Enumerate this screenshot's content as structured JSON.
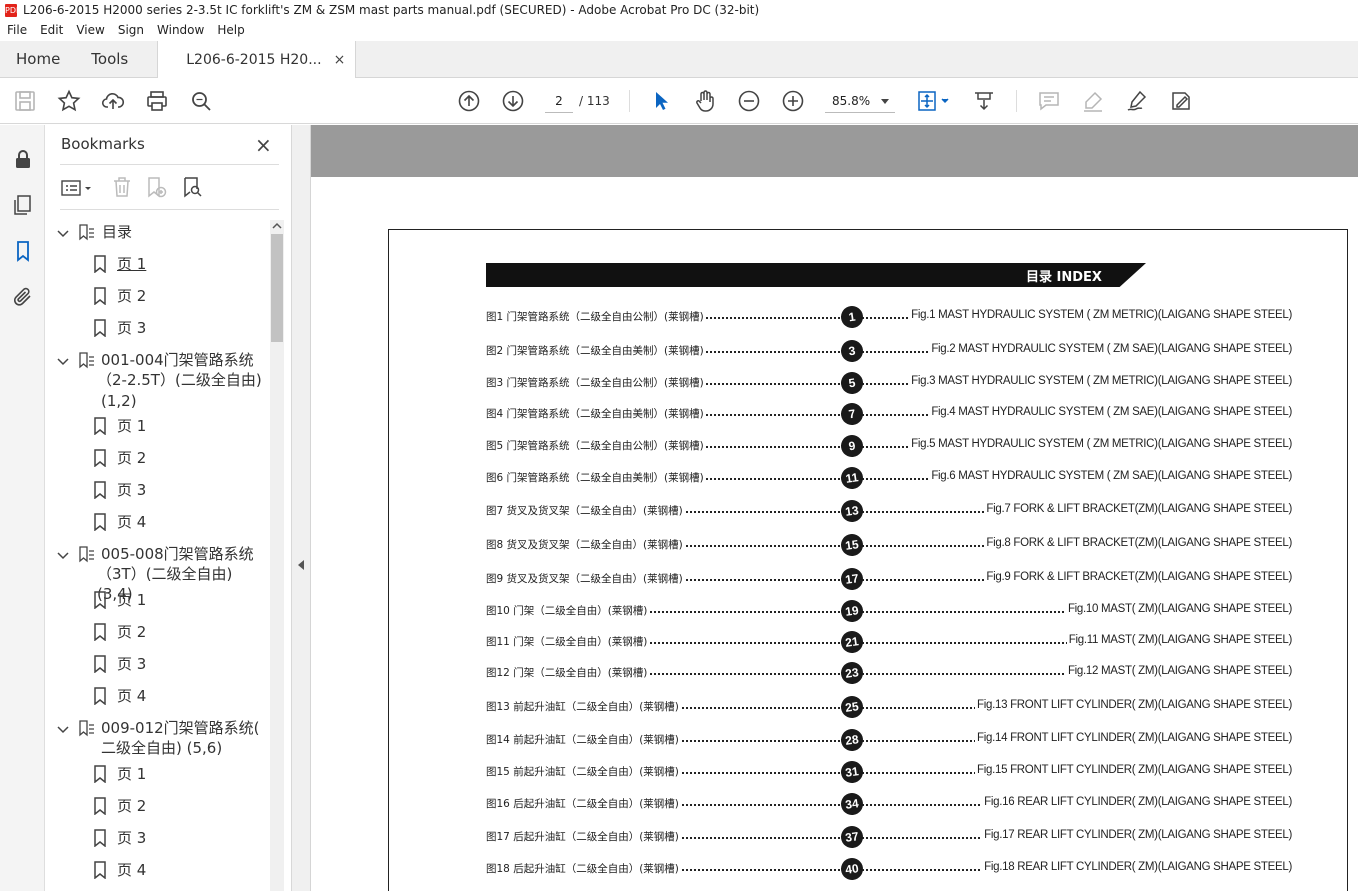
{
  "window": {
    "title": "L206-6-2015 H2000 series 2-3.5t IC forklift's ZM & ZSM mast parts manual.pdf (SECURED) - Adobe Acrobat Pro DC (32-bit)",
    "icon_label": "PDF"
  },
  "menu": [
    "File",
    "Edit",
    "View",
    "Sign",
    "Window",
    "Help"
  ],
  "tabs": {
    "home": "Home",
    "tools": "Tools",
    "document": "L206-6-2015 H20...",
    "close": "×"
  },
  "toolbar": {
    "current_page": "2",
    "total_pages": "/ 113",
    "zoom": "85.8%"
  },
  "bookmarks": {
    "title": "Bookmarks",
    "close": "×",
    "items": [
      {
        "label": "目录"
      },
      {
        "label": "页 1"
      },
      {
        "label": "页 2"
      },
      {
        "label": "页 3"
      },
      {
        "label": "001-004门架管路系统"
      },
      {
        "label": "（2-2.5T）(二级全自由)"
      },
      {
        "label": "(1,2)"
      },
      {
        "label": "页 1"
      },
      {
        "label": "页 2"
      },
      {
        "label": "页 3"
      },
      {
        "label": "页 4"
      },
      {
        "label": "005-008门架管路系统"
      },
      {
        "label": "（3T）(二级全自由) (3,4)"
      },
      {
        "label": "页 1"
      },
      {
        "label": "页 2"
      },
      {
        "label": "页 3"
      },
      {
        "label": "页 4"
      },
      {
        "label": "009-012门架管路系统("
      },
      {
        "label": "二级全自由) (5,6)"
      },
      {
        "label": "页 1"
      },
      {
        "label": "页 2"
      },
      {
        "label": "页 3"
      },
      {
        "label": "页 4"
      }
    ]
  },
  "document": {
    "heading": "目录 INDEX",
    "entries": [
      {
        "cn": "图1  门架管路系统（二级全自由公制）(莱钢槽)",
        "num": "1",
        "en": "Fig.1  MAST HYDRAULIC SYSTEM ( ZM METRIC)(LAIGANG SHAPE STEEL)"
      },
      {
        "cn": "图2  门架管路系统（二级全自由美制）(莱钢槽)",
        "num": "3",
        "en": "Fig.2 MAST HYDRAULIC SYSTEM ( ZM SAE)(LAIGANG SHAPE STEEL)"
      },
      {
        "cn": "图3  门架管路系统（二级全自由公制）(莱钢槽)",
        "num": "5",
        "en": "Fig.3 MAST HYDRAULIC SYSTEM ( ZM METRIC)(LAIGANG SHAPE STEEL)"
      },
      {
        "cn": "图4  门架管路系统（二级全自由美制）(莱钢槽)",
        "num": "7",
        "en": "Fig.4 MAST HYDRAULIC SYSTEM ( ZM SAE)(LAIGANG SHAPE STEEL)"
      },
      {
        "cn": "图5  门架管路系统（二级全自由公制）(莱钢槽)",
        "num": "9",
        "en": "Fig.5 MAST HYDRAULIC SYSTEM ( ZM METRIC)(LAIGANG SHAPE STEEL)"
      },
      {
        "cn": "图6  门架管路系统（二级全自由美制）(莱钢槽)",
        "num": "11",
        "en": "Fig.6 MAST HYDRAULIC SYSTEM ( ZM SAE)(LAIGANG SHAPE STEEL)"
      },
      {
        "cn": "图7  货叉及货叉架（二级全自由）(莱钢槽)",
        "num": "13",
        "en": "Fig.7 FORK & LIFT BRACKET(ZM)(LAIGANG SHAPE STEEL)"
      },
      {
        "cn": "图8  货叉及货叉架（二级全自由）(莱钢槽)",
        "num": "15",
        "en": "Fig.8 FORK & LIFT BRACKET(ZM)(LAIGANG SHAPE STEEL)"
      },
      {
        "cn": "图9  货叉及货叉架（二级全自由）(莱钢槽)",
        "num": "17",
        "en": "Fig.9 FORK & LIFT BRACKET(ZM)(LAIGANG SHAPE STEEL)"
      },
      {
        "cn": "图10  门架（二级全自由）(莱钢槽)",
        "num": "19",
        "en": "Fig.10 MAST( ZM)(LAIGANG SHAPE STEEL)"
      },
      {
        "cn": "图11  门架（二级全自由）(莱钢槽)",
        "num": "21",
        "en": "Fig.11 MAST( ZM)(LAIGANG SHAPE STEEL)"
      },
      {
        "cn": "图12  门架（二级全自由）(莱钢槽)",
        "num": "23",
        "en": "Fig.12 MAST( ZM)(LAIGANG SHAPE STEEL)"
      },
      {
        "cn": "图13  前起升油缸（二级全自由）(莱钢槽)",
        "num": "25",
        "en": "Fig.13 FRONT LIFT CYLINDER( ZM)(LAIGANG SHAPE STEEL)"
      },
      {
        "cn": "图14  前起升油缸（二级全自由）(莱钢槽)",
        "num": "28",
        "en": "Fig.14 FRONT LIFT CYLINDER( ZM)(LAIGANG SHAPE STEEL)"
      },
      {
        "cn": "图15  前起升油缸（二级全自由）(莱钢槽)",
        "num": "31",
        "en": "Fig.15 FRONT LIFT CYLINDER( ZM)(LAIGANG SHAPE STEEL)"
      },
      {
        "cn": "图16  后起升油缸（二级全自由）(莱钢槽)",
        "num": "34",
        "en": "Fig.16 REAR LIFT CYLINDER( ZM)(LAIGANG SHAPE STEEL)"
      },
      {
        "cn": "图17  后起升油缸（二级全自由）(莱钢槽)",
        "num": "37",
        "en": "Fig.17 REAR LIFT CYLINDER( ZM)(LAIGANG SHAPE STEEL)"
      },
      {
        "cn": "图18  后起升油缸（二级全自由）(莱钢槽)",
        "num": "40",
        "en": "Fig.18 REAR LIFT CYLINDER( ZM)(LAIGANG SHAPE STEEL)"
      }
    ]
  },
  "colors": {
    "accent": "#0b65c2",
    "banner": "#111111",
    "viewer_bg": "#9a9a9a"
  }
}
